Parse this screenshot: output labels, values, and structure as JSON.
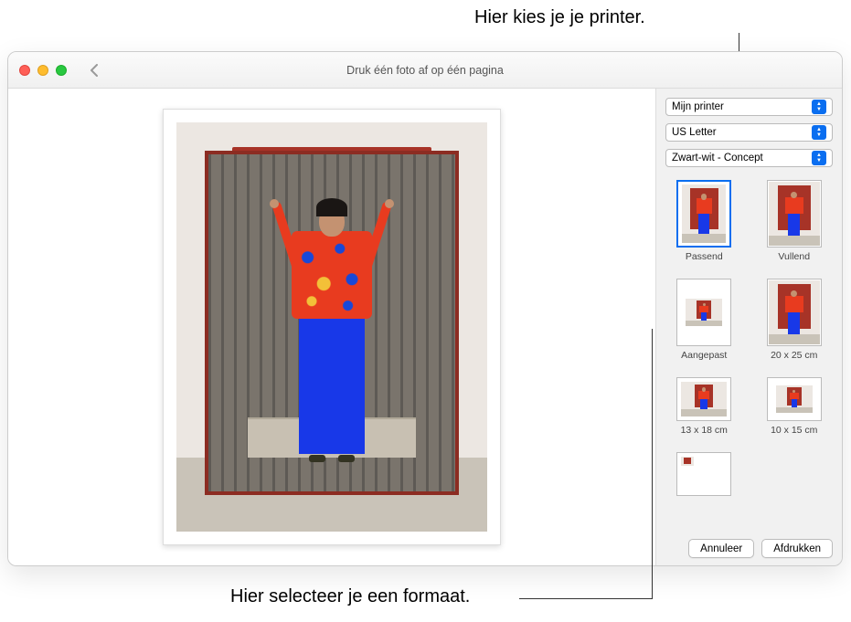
{
  "callouts": {
    "top": "Hier kies je je printer.",
    "bottom": "Hier selecteer je een formaat."
  },
  "window": {
    "title": "Druk één foto af op één pagina"
  },
  "sidebar": {
    "printer": "Mijn printer",
    "paper_size": "US Letter",
    "quality": "Zwart-wit - Concept",
    "formats": [
      {
        "label": "Passend",
        "type": "portrait",
        "fill": "fit",
        "selected": true
      },
      {
        "label": "Vullend",
        "type": "portrait",
        "fill": "fill",
        "selected": false
      },
      {
        "label": "Aangepast",
        "type": "portrait",
        "fill": "custom",
        "selected": false
      },
      {
        "label": "20 x 25 cm",
        "type": "portrait",
        "fill": "fill",
        "selected": false
      },
      {
        "label": "13 x 18 cm",
        "type": "landscape",
        "fill": "large",
        "selected": false
      },
      {
        "label": "10 x 15 cm",
        "type": "landscape",
        "fill": "small",
        "selected": false
      },
      {
        "label": "",
        "type": "landscape",
        "fill": "tiny",
        "selected": false
      }
    ],
    "buttons": {
      "cancel": "Annuleer",
      "print": "Afdrukken"
    }
  }
}
